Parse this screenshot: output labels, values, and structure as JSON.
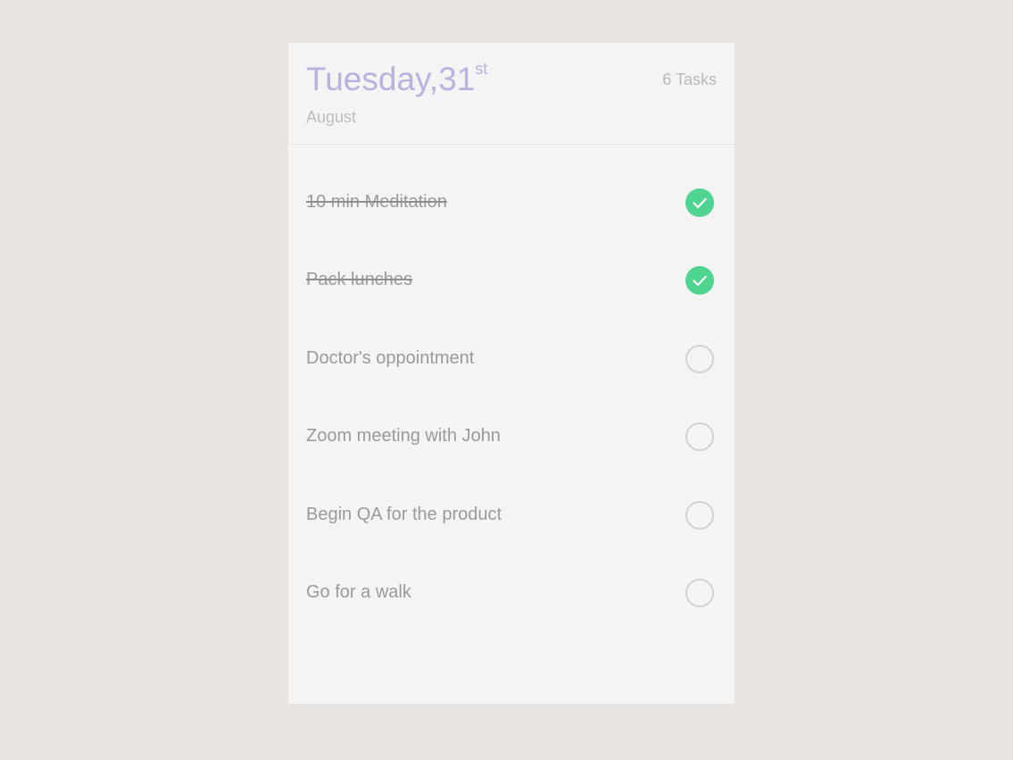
{
  "header": {
    "day": "Tuesday,",
    "date_number": "31",
    "date_suffix": "st",
    "month": "August",
    "task_count": "6 Tasks"
  },
  "tasks": [
    {
      "label": "10 min Meditation",
      "done": true,
      "check_icon": "check-icon"
    },
    {
      "label": "Pack lunches",
      "done": true,
      "check_icon": "check-icon"
    },
    {
      "label": "Doctor's oppointment",
      "done": false
    },
    {
      "label": "Zoom meeting with John",
      "done": false
    },
    {
      "label": "Begin QA for the product",
      "done": false
    },
    {
      "label": "Go for a walk",
      "done": false
    }
  ],
  "colors": {
    "background": "#e8e3df",
    "card": "#f4f4f4",
    "title": "#b9b2e0",
    "done_check": "#4fd491",
    "task_text": "#9a9a9a",
    "unchecked_border": "#d2d2d2"
  }
}
